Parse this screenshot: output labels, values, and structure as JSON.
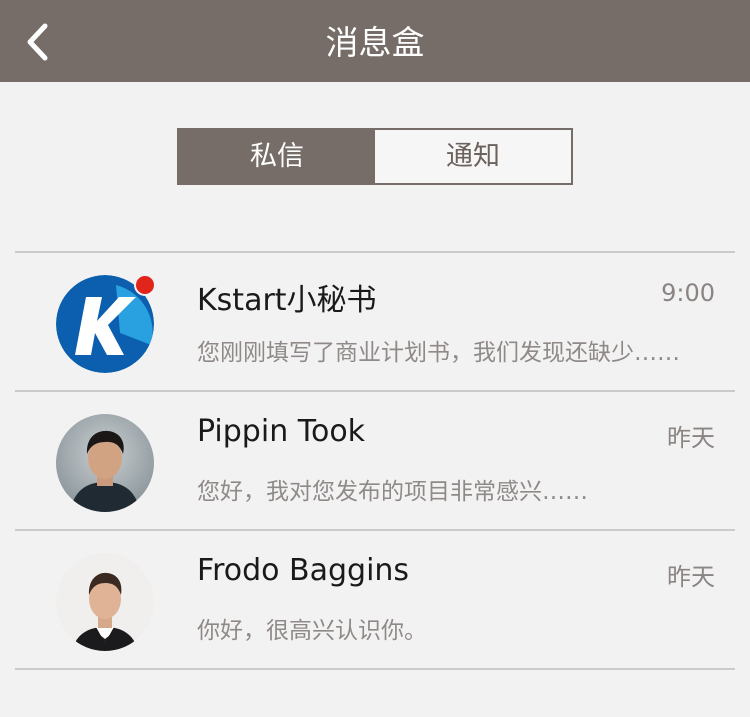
{
  "header": {
    "title": "消息盒",
    "back_icon": "chevron-left-icon",
    "background": "#776d68"
  },
  "tabs": [
    {
      "label": "私信",
      "active": true
    },
    {
      "label": "通知",
      "active": false
    }
  ],
  "messages": [
    {
      "name": "Kstart小秘书",
      "time": "9:00",
      "preview": "您刚刚填写了商业计划书，我们发现还缺少……",
      "avatar": "kstart-logo",
      "unread": true
    },
    {
      "name": "Pippin Took",
      "time": "昨天",
      "preview": "您好，我对您发布的项目非常感兴……",
      "avatar": "user-photo",
      "unread": false
    },
    {
      "name": "Frodo Baggins",
      "time": "昨天",
      "preview": "你好，很高兴认识你。",
      "avatar": "user-photo",
      "unread": false
    }
  ],
  "colors": {
    "accent": "#776d68",
    "background": "#f3f2f2",
    "unread_dot": "#e1251b"
  }
}
